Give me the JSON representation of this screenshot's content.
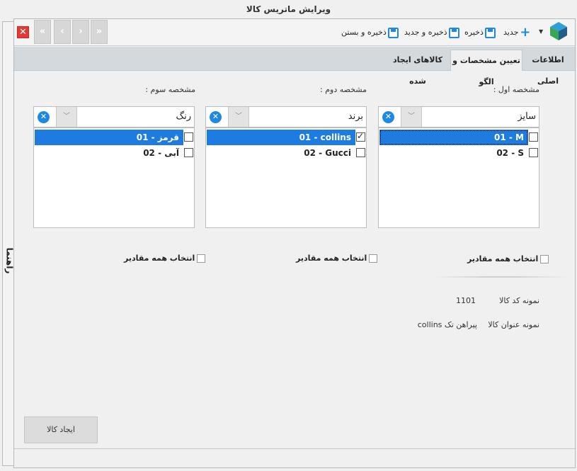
{
  "window": {
    "title": "ویرایش ماتریس کالا"
  },
  "side_tab": {
    "label": "راهنما"
  },
  "toolbar": {
    "new_label": "جدید",
    "save_label": "ذخیره",
    "save_new_label": "ذخیره و جدید",
    "save_close_label": "ذخیره و بستن",
    "nav": {
      "first": "«",
      "prev": "‹",
      "next": "›",
      "last": "»"
    },
    "close": "✕"
  },
  "tabs": [
    {
      "label": "اطلاعات اصلی"
    },
    {
      "label": "تعیین مشخصات و الگو"
    },
    {
      "label": "کالاهای ایجاد شده"
    }
  ],
  "specs": [
    {
      "label": "مشخصه اول :",
      "selected": "سایز",
      "items": [
        {
          "text": "01 - M",
          "checked": false,
          "selected": true
        },
        {
          "text": "02 - S",
          "checked": false,
          "selected": false
        }
      ],
      "select_all": "انتخاب همه مقادیر"
    },
    {
      "label": "مشخصه دوم :",
      "selected": "برند",
      "items": [
        {
          "text": "01 - collins",
          "checked": true,
          "selected": true
        },
        {
          "text": "02 - Gucci",
          "checked": false,
          "selected": false
        }
      ],
      "select_all": "انتخاب همه مقادیر"
    },
    {
      "label": "مشخصه سوم :",
      "selected": "رنگ",
      "items": [
        {
          "text": "01 - قرمز",
          "checked": false,
          "selected": true
        },
        {
          "text": "02 - آبی",
          "checked": false,
          "selected": false
        }
      ],
      "select_all": "انتخاب همه مقادیر"
    }
  ],
  "sample": {
    "code_label": "نمونه کد کالا",
    "code_value": "1101",
    "title_label": "نمونه عنوان کالا",
    "title_value": "پیراهن تک collins"
  },
  "create_button": "ایجاد کالا",
  "colors": {
    "accent": "#1e7be0",
    "close": "#e53935",
    "tabbar": "#d4d9de"
  }
}
